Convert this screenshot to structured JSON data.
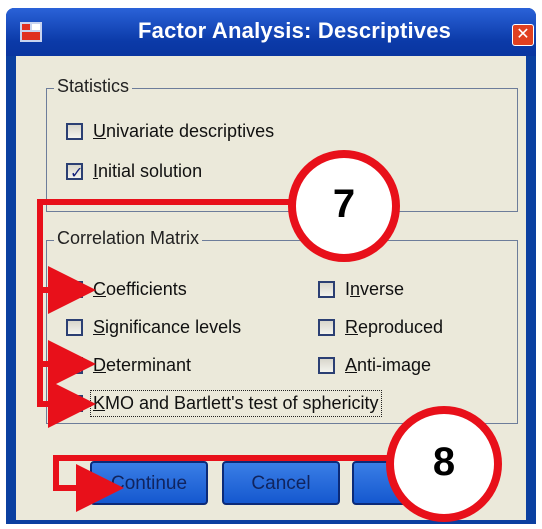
{
  "window": {
    "title": "Factor Analysis: Descriptives",
    "close_glyph": "✕"
  },
  "statistics": {
    "title": "Statistics",
    "items": [
      {
        "label": "Univariate descriptives",
        "checked": false
      },
      {
        "label": "Initial solution",
        "checked": true
      }
    ]
  },
  "correlation": {
    "title": "Correlation Matrix",
    "items": [
      {
        "label": "Coefficients",
        "checked": true
      },
      {
        "label": "Inverse",
        "checked": false
      },
      {
        "label": "Significance levels",
        "checked": false
      },
      {
        "label": "Reproduced",
        "checked": false
      },
      {
        "label": "Determinant",
        "checked": true
      },
      {
        "label": "Anti-image",
        "checked": false
      },
      {
        "label": "KMO and Bartlett's test of sphericity",
        "checked": true
      }
    ]
  },
  "buttons": {
    "continue": "Continue",
    "cancel": "Cancel"
  },
  "annotations": {
    "callout_7": "7",
    "callout_8": "8"
  },
  "colors": {
    "title_bar": "#0b3aa8",
    "dialog_bg": "#ebe9da",
    "callout_red": "#e8101a",
    "button": "#2a6ee0"
  },
  "icons": {
    "app": "spss-dialog-icon",
    "close": "close-icon",
    "check": "checkmark-icon"
  }
}
